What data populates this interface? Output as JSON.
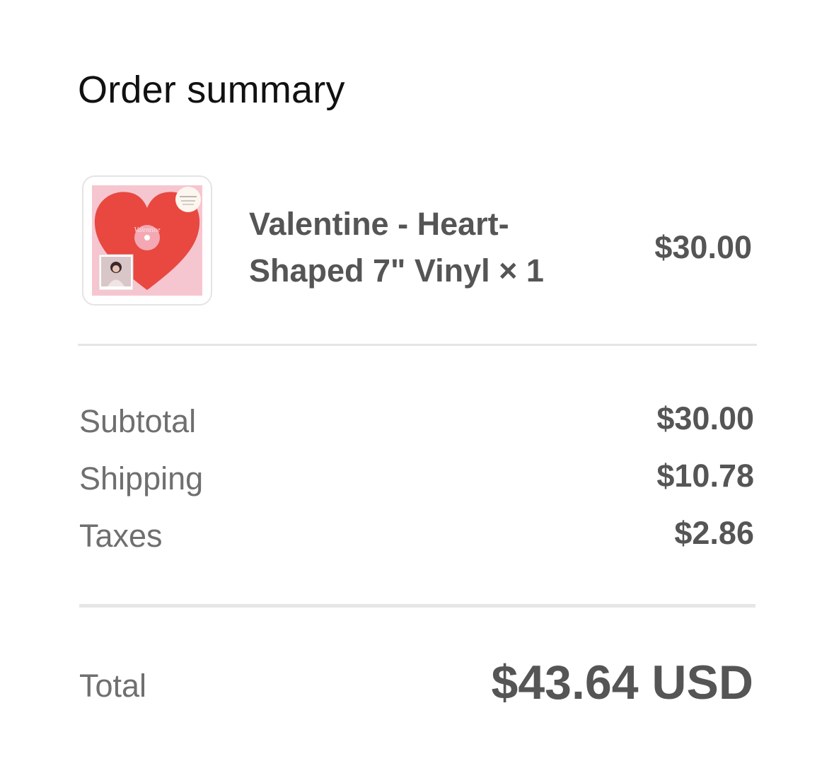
{
  "header": {
    "title": "Order summary"
  },
  "product": {
    "image_icon": "vinyl-album-cover",
    "cover_text": "Valentine",
    "name": "Valentine - Heart-Shaped 7\" Vinyl × 1",
    "price": "$30.00"
  },
  "summary": {
    "rows": [
      {
        "label": "Subtotal",
        "value": "$30.00"
      },
      {
        "label": "Shipping",
        "value": "$10.78"
      },
      {
        "label": "Taxes",
        "value": "$2.86"
      }
    ]
  },
  "total": {
    "label": "Total",
    "value": "$43.64 USD"
  },
  "colors": {
    "heart_red": "#e8483f",
    "cover_pink": "#f6c6d0",
    "text_dark": "#555555",
    "text_muted": "#6f6f6f",
    "divider": "#e6e6e6"
  }
}
